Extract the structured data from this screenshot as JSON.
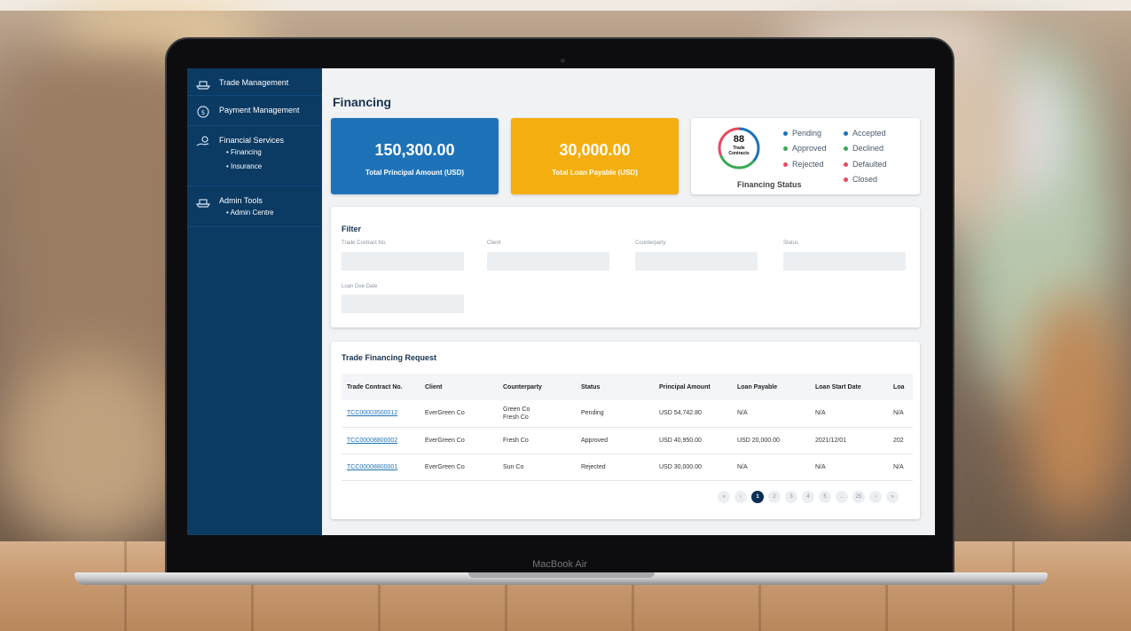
{
  "device": {
    "label": "MacBook Air"
  },
  "colors": {
    "sidebar": "#0b3a63",
    "accent_blue": "#1e73b8",
    "accent_orange": "#f5ae0f",
    "pending": "#1e73b8",
    "approved": "#3aa856",
    "rejected": "#e84a5f",
    "accepted": "#1e73b8",
    "declined": "#3aa856",
    "defaulted": "#e84a5f",
    "closed": "#e84a5f"
  },
  "sidebar": {
    "items": [
      {
        "label": "Trade Management",
        "icon": "ship-icon"
      },
      {
        "label": "Payment Management",
        "icon": "coin-icon"
      },
      {
        "label": "Financial Services",
        "icon": "hand-coin-icon",
        "children": [
          "• Financing",
          "• Insurance"
        ]
      },
      {
        "label": "Admin Tools",
        "icon": "ship-icon",
        "children": [
          "• Admin Centre"
        ]
      }
    ]
  },
  "page": {
    "title": "Financing"
  },
  "kpis": [
    {
      "value": "150,300.00",
      "label": "Total Principal Amount (USD)"
    },
    {
      "value": "30,000.00",
      "label": "Total Loan Payable (USD)"
    }
  ],
  "status": {
    "total": "88",
    "caption_line1": "Trade",
    "caption_line2": "Contracts",
    "title": "Financing Status",
    "legend": [
      "Pending",
      "Accepted",
      "Approved",
      "Declined",
      "Rejected",
      "Defaulted",
      "Closed"
    ]
  },
  "filter": {
    "title": "Filter",
    "fields": [
      "Trade Contract No.",
      "Client",
      "Counterparty",
      "Status",
      "Loan Due Date"
    ]
  },
  "requests": {
    "title": "Trade Financing Request",
    "columns": [
      "Trade Contract No.",
      "Client",
      "Counterparty",
      "Status",
      "Principal Amount",
      "Loan Payable",
      "Loan Start Date",
      "Loa"
    ],
    "rows": [
      [
        "TCC00003500012",
        "EverGreen Co",
        "Green Co\nFresh Co",
        "Pending",
        "USD 54,742.80",
        "N/A",
        "N/A",
        "N/A"
      ],
      [
        "TCC00008800002",
        "EverGreen Co",
        "Fresh Co",
        "Approved",
        "USD 40,950.00",
        "USD 20,000.00",
        "2021/12/01",
        "202"
      ],
      [
        "TCC00008800001",
        "EverGreen Co",
        "Sun Co",
        "Rejected",
        "USD 30,000.00",
        "N/A",
        "N/A",
        "N/A"
      ]
    ]
  },
  "pagination": {
    "items": [
      "«",
      "‹",
      "1",
      "2",
      "3",
      "4",
      "5",
      "...",
      "25",
      "›",
      "»"
    ],
    "active": "1"
  }
}
